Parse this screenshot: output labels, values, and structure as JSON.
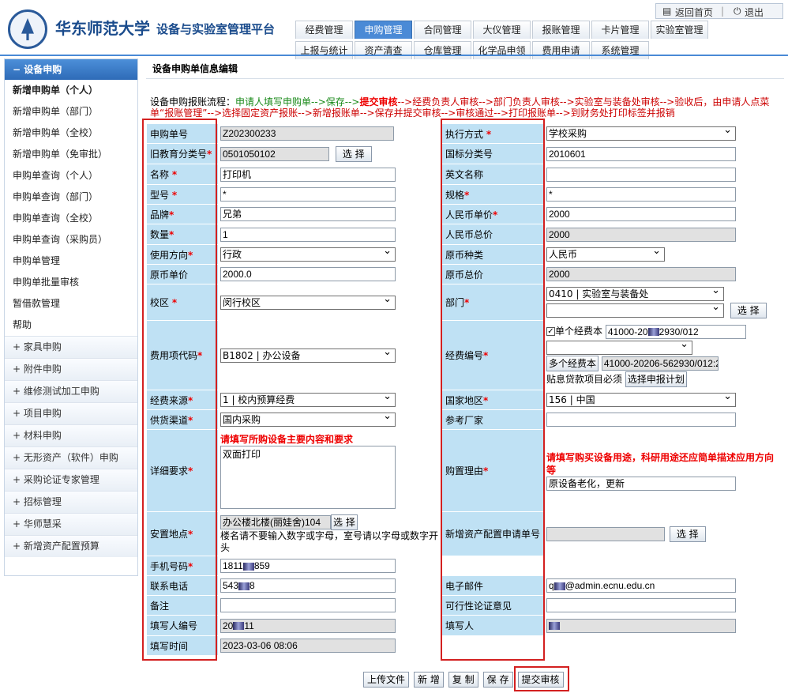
{
  "header": {
    "university": "华东师范大学",
    "platform": "设备与实验室管理平台",
    "back_home": "返回首页",
    "logout": "退出"
  },
  "tabs_row1": [
    "经费管理",
    "申购管理",
    "合同管理",
    "大仪管理",
    "报账管理",
    "卡片管理",
    "实验室管理"
  ],
  "tabs_row2": [
    "上报与统计",
    "资产清查",
    "仓库管理",
    "化学品申领",
    "费用申请",
    "系统管理"
  ],
  "sidebar": {
    "section": "设备申购",
    "items": [
      "新增申购单（个人）",
      "新增申购单（部门）",
      "新增申购单（全校）",
      "新增申购单（免审批）",
      "申购单查询（个人）",
      "申购单查询（部门）",
      "申购单查询（全校）",
      "申购单查询（采购员）",
      "申购单管理",
      "申购单批量审核",
      "暂借款管理",
      "帮助"
    ],
    "groups": [
      "家具申购",
      "附件申购",
      "维修测试加工申购",
      "项目申购",
      "材料申购",
      "无形资产（软件）申购",
      "采购论证专家管理",
      "招标管理",
      "华师慧采",
      "新增资产配置预算"
    ]
  },
  "main": {
    "title": "设备申购单信息编辑",
    "flow_prefix": "设备申购报账流程：",
    "flow_green1": "申请人填写申购单",
    "flow_arrow1": "-->保存-->",
    "flow_submit": "提交审核",
    "flow_mid": "-->经费负责人审核-->部门负责人审核-->实验室与装备处审核-->验收后，由申请人点菜单“报账管理”-->选择固定资产报账-->新增报账单-->保存并提交审核-->审核通过-->打印报账单-->到财务处打印标签并报销"
  },
  "form": {
    "left": {
      "order_no_label": "申购单号",
      "order_no": "Z202300233",
      "old_class_label": "旧教育分类号",
      "old_class": "0501050102",
      "name_label": "名称",
      "name": "打印机",
      "model_label": "型号",
      "model": "*",
      "brand_label": "品牌",
      "brand": "兄弟",
      "qty_label": "数量",
      "qty": "1",
      "usage_label": "使用方向",
      "usage": "行政",
      "orig_price_label": "原币单价",
      "orig_price": "2000.0",
      "campus_label": "校区",
      "campus": "闵行校区",
      "fee_code_label": "费用项代码",
      "fee_code": "B1802 | 办公设备",
      "fund_source_label": "经费来源",
      "fund_source": "1 | 校内预算经费",
      "supply_label": "供货渠道",
      "supply": "国内采购",
      "detail_label": "详细要求",
      "detail_hint": "请填写所购设备主要内容和要求",
      "detail": "双面打印",
      "location_label": "安置地点",
      "location": "办公楼北楼(丽娃舍)104",
      "location_hint": "楼名请不要输入数字或字母，室号请以字母或数字开头",
      "mobile_label": "手机号码",
      "mobile_a": "1811",
      "mobile_b": "859",
      "phone_label": "联系电话",
      "phone_a": "543",
      "phone_b": "8",
      "remark_label": "备注",
      "remark": "",
      "filler_no_label": "填写人编号",
      "filler_no_a": "20",
      "filler_no_b": "11",
      "fill_time_label": "填写时间",
      "fill_time": "2023-03-06 08:06"
    },
    "right": {
      "exec_label": "执行方式",
      "exec": "学校采购",
      "intl_class_label": "国标分类号",
      "intl_class": "2010601",
      "en_name_label": "英文名称",
      "en_name": "",
      "spec_label": "规格",
      "spec": "*",
      "unit_price_label": "人民币单价",
      "unit_price": "2000",
      "total_label": "人民币总价",
      "total": "2000",
      "currency_label": "原币种类",
      "currency": "人民币",
      "orig_total_label": "原币总价",
      "orig_total": "2000",
      "dept_label": "部门",
      "dept": "0410 | 实验室与装备处",
      "dept2": "",
      "fund_no_label": "经费编号",
      "single_fund": "单个经费本",
      "single_fund_val_a": "41000-20",
      "single_fund_val_b": "2930/012",
      "multi_fund": "多个经费本",
      "multi_fund_val": "41000-20206-562930/012:2",
      "loan_note": "贴息贷款项目必须",
      "loan_btn": "选择申报计划",
      "country_label": "国家地区",
      "country": "156 | 中国",
      "vendor_label": "参考厂家",
      "vendor": "",
      "reason_label": "购置理由",
      "reason_hint": "请填写购买设备用途，科研用途还应简单描述应用方向等",
      "reason": "原设备老化，更新",
      "config_no_label": "新增资产配置申请单号",
      "config_no": "",
      "email_label": "电子邮件",
      "email_a": "q",
      "email_b": "@admin.ecnu.edu.cn",
      "feasibility_label": "可行性论证意见",
      "feasibility": "",
      "filler_label": "填写人",
      "filler": ""
    },
    "select_btn": "选 择"
  },
  "buttons": {
    "upload": "上传文件",
    "add": "新 增",
    "copy": "复 制",
    "save": "保 存",
    "submit": "提交审核"
  }
}
